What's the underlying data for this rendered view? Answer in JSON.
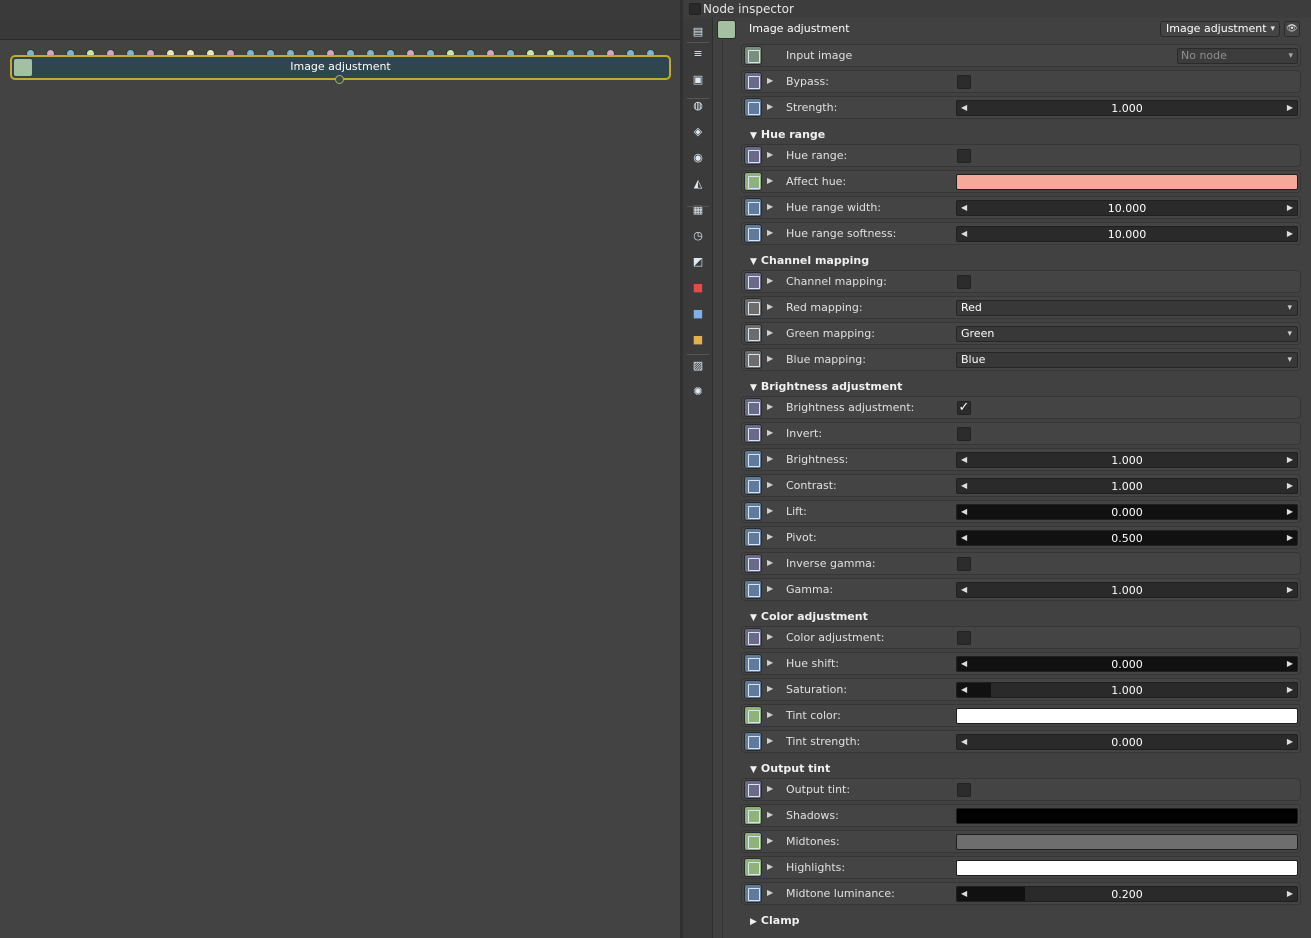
{
  "graph": {
    "node_title": "Image adjustment",
    "pin_colors": [
      "#7fb6d6",
      "#d8a3c8",
      "#7fb6d6",
      "#c9e8a7",
      "#d8a3c8",
      "#7fb6d6",
      "#d8a3c8",
      "#ede6b8",
      "#ede6b8",
      "#ede6b8",
      "#d8a3c8",
      "#7fb6d6",
      "#7fb6d6",
      "#7fb6d6",
      "#7fb6d6",
      "#d8a3c8",
      "#7fb6d6",
      "#7fb6d6",
      "#7fb6d6",
      "#d8a3c8",
      "#7fb6d6",
      "#c9e8a7",
      "#7fb6d6",
      "#d8a3c8",
      "#7fb6d6",
      "#c9e8a7",
      "#c9e8a7",
      "#7fb6d6",
      "#7fb6d6",
      "#d8a3c8",
      "#7fb6d6",
      "#7fb6d6"
    ]
  },
  "inspector": {
    "title": "Node inspector",
    "node_name": "Image adjustment",
    "node_type": "Image adjustment",
    "input_label": "Input image",
    "input_value": "No node"
  },
  "toolbar_icons": [
    "layers-icon",
    "list-icon",
    "image-icon",
    "camera-icon",
    "geometry-icon",
    "stack-icon",
    "material-icon",
    "texture-icon",
    "clock-icon",
    "transform-icon",
    "red-cube-icon",
    "blue-cube-icon",
    "box-icon",
    "picture-icon",
    "sun-icon"
  ],
  "rows": [
    {
      "type": "bool",
      "label": "Bypass:",
      "checked": false
    },
    {
      "type": "float",
      "label": "Strength:",
      "value": "1.000",
      "fill": 0
    },
    {
      "section": "Hue range"
    },
    {
      "type": "bool",
      "label": "Hue range:",
      "checked": false
    },
    {
      "type": "color",
      "label": "Affect hue:",
      "color": "#f4a99b"
    },
    {
      "type": "float",
      "label": "Hue range width:",
      "value": "10.000",
      "fill": 0
    },
    {
      "type": "float",
      "label": "Hue range softness:",
      "value": "10.000",
      "fill": 0
    },
    {
      "section": "Channel mapping"
    },
    {
      "type": "bool",
      "label": "Channel mapping:",
      "checked": false
    },
    {
      "type": "enum",
      "label": "Red mapping:",
      "value": "Red"
    },
    {
      "type": "enum",
      "label": "Green mapping:",
      "value": "Green"
    },
    {
      "type": "enum",
      "label": "Blue mapping:",
      "value": "Blue"
    },
    {
      "section": "Brightness adjustment"
    },
    {
      "type": "bool",
      "label": "Brightness adjustment:",
      "checked": true
    },
    {
      "type": "bool",
      "label": "Invert:",
      "checked": false
    },
    {
      "type": "float",
      "label": "Brightness:",
      "value": "1.000",
      "fill": 0
    },
    {
      "type": "float",
      "label": "Contrast:",
      "value": "1.000",
      "fill": 0
    },
    {
      "type": "float",
      "label": "Lift:",
      "value": "0.000",
      "fill": 1
    },
    {
      "type": "float",
      "label": "Pivot:",
      "value": "0.500",
      "fill": 1
    },
    {
      "type": "bool",
      "label": "Inverse gamma:",
      "checked": false
    },
    {
      "type": "float",
      "label": "Gamma:",
      "value": "1.000",
      "fill": 0
    },
    {
      "section": "Color adjustment"
    },
    {
      "type": "bool",
      "label": "Color adjustment:",
      "checked": false
    },
    {
      "type": "float",
      "label": "Hue shift:",
      "value": "0.000",
      "fill": 1
    },
    {
      "type": "float",
      "label": "Saturation:",
      "value": "1.000",
      "fill": 0.1
    },
    {
      "type": "color",
      "label": "Tint color:",
      "color": "#ffffff"
    },
    {
      "type": "float",
      "label": "Tint strength:",
      "value": "0.000",
      "fill": 0
    },
    {
      "section": "Output tint"
    },
    {
      "type": "bool",
      "label": "Output tint:",
      "checked": false
    },
    {
      "type": "color",
      "label": "Shadows:",
      "color": "#000000"
    },
    {
      "type": "color",
      "label": "Midtones:",
      "color": "#6e6e6e"
    },
    {
      "type": "color",
      "label": "Highlights:",
      "color": "#ffffff"
    },
    {
      "type": "float",
      "label": "Midtone luminance:",
      "value": "0.200",
      "fill": 0.2
    },
    {
      "section": "Clamp",
      "collapsed": true
    }
  ]
}
